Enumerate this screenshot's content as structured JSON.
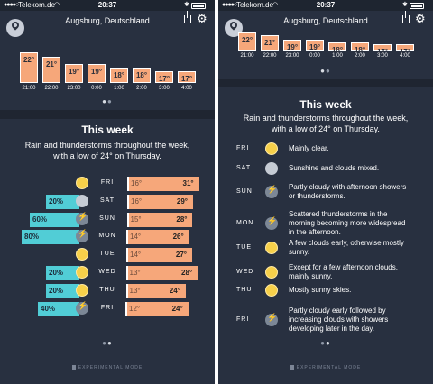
{
  "status": {
    "carrier": "Telekom.de",
    "time": "20:37",
    "signal": "●●●●○",
    "wifi_icon": "wifi-icon",
    "bluetooth": "✱"
  },
  "header": {
    "location": "Augsburg, Deutschland",
    "location_icon": "location-pin-icon",
    "share_icon": "share-icon",
    "settings_icon": "gear-icon",
    "gear_glyph": "⚙"
  },
  "hourly": {
    "hours": [
      {
        "time": "21:00",
        "temp": "22°",
        "value": 22
      },
      {
        "time": "22:00",
        "temp": "21°",
        "value": 21
      },
      {
        "time": "23:00",
        "temp": "19°",
        "value": 19
      },
      {
        "time": "0:00",
        "temp": "19°",
        "value": 19
      },
      {
        "time": "1:00",
        "temp": "18°",
        "value": 18
      },
      {
        "time": "2:00",
        "temp": "18°",
        "value": 18
      },
      {
        "time": "3:00",
        "temp": "17°",
        "value": 17
      },
      {
        "time": "4:00",
        "temp": "17°",
        "value": 17
      }
    ]
  },
  "week": {
    "title": "This week",
    "summary_line1": "Rain and thunderstorms throughout the week,",
    "summary_line2": "with a low of 24° on Thursday.",
    "days": [
      {
        "day": "FRI",
        "icon": "sun-icon",
        "pop": "",
        "low": "16°",
        "high": "31°",
        "low_value": 16,
        "high_value": 31,
        "desc": [
          "Mainly clear."
        ]
      },
      {
        "day": "SAT",
        "icon": "partly-cloudy-icon",
        "pop": "20%",
        "low": "16°",
        "high": "29°",
        "low_value": 16,
        "high_value": 29,
        "desc": [
          "Sunshine and clouds mixed."
        ]
      },
      {
        "day": "SUN",
        "icon": "thunderstorm-icon",
        "pop": "60%",
        "low": "15°",
        "high": "28°",
        "low_value": 15,
        "high_value": 28,
        "desc": [
          "Partly cloudy with afternoon showers",
          "or thunderstorms."
        ]
      },
      {
        "day": "MON",
        "icon": "thunderstorm-icon",
        "pop": "80%",
        "low": "14°",
        "high": "26°",
        "low_value": 14,
        "high_value": 26,
        "desc": [
          "Scattered thunderstorms in the",
          "morning becoming more widespread",
          "in the afternoon."
        ]
      },
      {
        "day": "TUE",
        "icon": "sun-icon",
        "pop": "",
        "low": "14°",
        "high": "27°",
        "low_value": 14,
        "high_value": 27,
        "desc": [
          "A few clouds early, otherwise mostly",
          "sunny."
        ]
      },
      {
        "day": "WED",
        "icon": "sun-icon",
        "pop": "20%",
        "low": "13°",
        "high": "28°",
        "low_value": 13,
        "high_value": 28,
        "desc": [
          "Except for a few afternoon clouds,",
          "mainly sunny."
        ]
      },
      {
        "day": "THU",
        "icon": "sun-icon",
        "pop": "20%",
        "low": "13°",
        "high": "24°",
        "low_value": 13,
        "high_value": 24,
        "desc": [
          "Mostly sunny skies."
        ]
      },
      {
        "day": "FRI",
        "icon": "thunderstorm-icon",
        "pop": "40%",
        "low": "12°",
        "high": "24°",
        "low_value": 12,
        "high_value": 24,
        "desc": [
          "Partly cloudy early followed by",
          "increasing clouds with showers",
          "developing later in the day."
        ]
      }
    ]
  },
  "pager": {
    "dots": "●●",
    "active_index": 0
  },
  "footer": {
    "experimental_label": "EXPERIMENTAL MODE"
  },
  "colors": {
    "background": "#283040",
    "temp_bar": "#f6a77a",
    "precip_badge": "#51cdd6",
    "sun": "#f7d04a"
  }
}
